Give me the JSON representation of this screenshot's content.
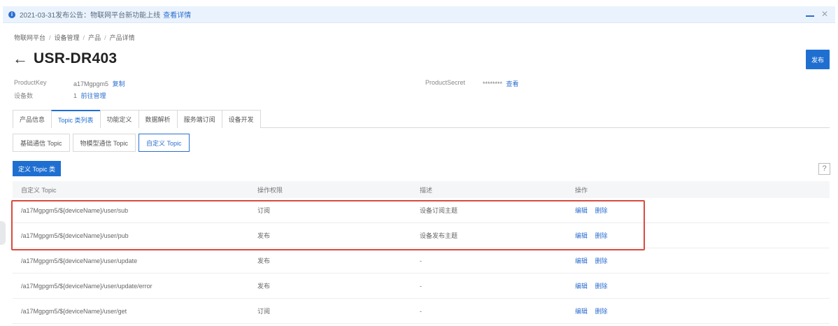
{
  "notice": {
    "text": "2021-03-31发布公告：物联网平台新功能上线",
    "link": "查看详情"
  },
  "breadcrumb": [
    "物联网平台",
    "设备管理",
    "产品",
    "产品详情"
  ],
  "product": {
    "name": "USR-DR403",
    "publish_label": "发布"
  },
  "meta": {
    "product_key_label": "ProductKey",
    "product_key_value": "a17Mgpgm5",
    "copy_label": "复制",
    "device_count_label": "设备数",
    "device_count_value": "1",
    "manage_label": "前往管理",
    "product_secret_label": "ProductSecret",
    "product_secret_value": "********",
    "view_label": "查看"
  },
  "tabs": [
    "产品信息",
    "Topic 类列表",
    "功能定义",
    "数据解析",
    "服务端订阅",
    "设备开发"
  ],
  "subtabs": [
    "基础通信 Topic",
    "物模型通信 Topic",
    "自定义 Topic"
  ],
  "define_button": "定义 Topic 类",
  "table": {
    "headers": [
      "自定义 Topic",
      "操作权限",
      "描述",
      "操作"
    ],
    "edit_label": "编辑",
    "delete_label": "删除",
    "rows": [
      {
        "topic": "/a17Mgpgm5/${deviceName}/user/sub",
        "perm": "订阅",
        "desc": "设备订阅主题"
      },
      {
        "topic": "/a17Mgpgm5/${deviceName}/user/pub",
        "perm": "发布",
        "desc": "设备发布主题"
      },
      {
        "topic": "/a17Mgpgm5/${deviceName}/user/update",
        "perm": "发布",
        "desc": "-"
      },
      {
        "topic": "/a17Mgpgm5/${deviceName}/user/update/error",
        "perm": "发布",
        "desc": "-"
      },
      {
        "topic": "/a17Mgpgm5/${deviceName}/user/get",
        "perm": "订阅",
        "desc": "-"
      }
    ]
  },
  "colors": {
    "accent": "#1f6fd1",
    "highlight": "#d84b3f"
  }
}
